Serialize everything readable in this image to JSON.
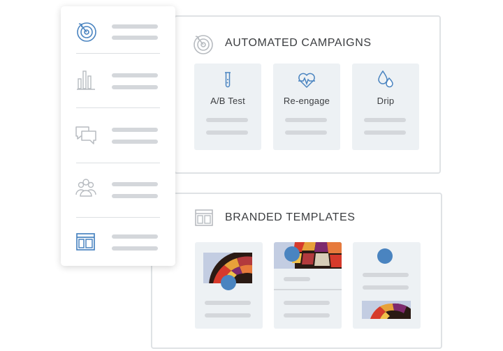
{
  "campaigns": {
    "title": "AUTOMATED CAMPAIGNS",
    "icon": "target-icon",
    "cards": [
      {
        "label": "A/B Test",
        "icon": "test-tube-icon"
      },
      {
        "label": "Re-engage",
        "icon": "heartbeat-icon"
      },
      {
        "label": "Drip",
        "icon": "water-drops-icon"
      }
    ]
  },
  "templates": {
    "title": "BRANDED TEMPLATES",
    "icon": "layout-icon"
  },
  "sidebar": {
    "items": [
      {
        "icon": "target-icon",
        "active": true
      },
      {
        "icon": "bar-chart-icon",
        "active": false
      },
      {
        "icon": "chat-bubbles-icon",
        "active": false
      },
      {
        "icon": "people-icon",
        "active": false
      },
      {
        "icon": "layout-icon",
        "active": true
      }
    ]
  },
  "colors": {
    "accent": "#4a84c0",
    "card_bg": "#edf1f4",
    "placeholder": "#d4d7db",
    "inactive_icon": "#b7bbc0"
  }
}
